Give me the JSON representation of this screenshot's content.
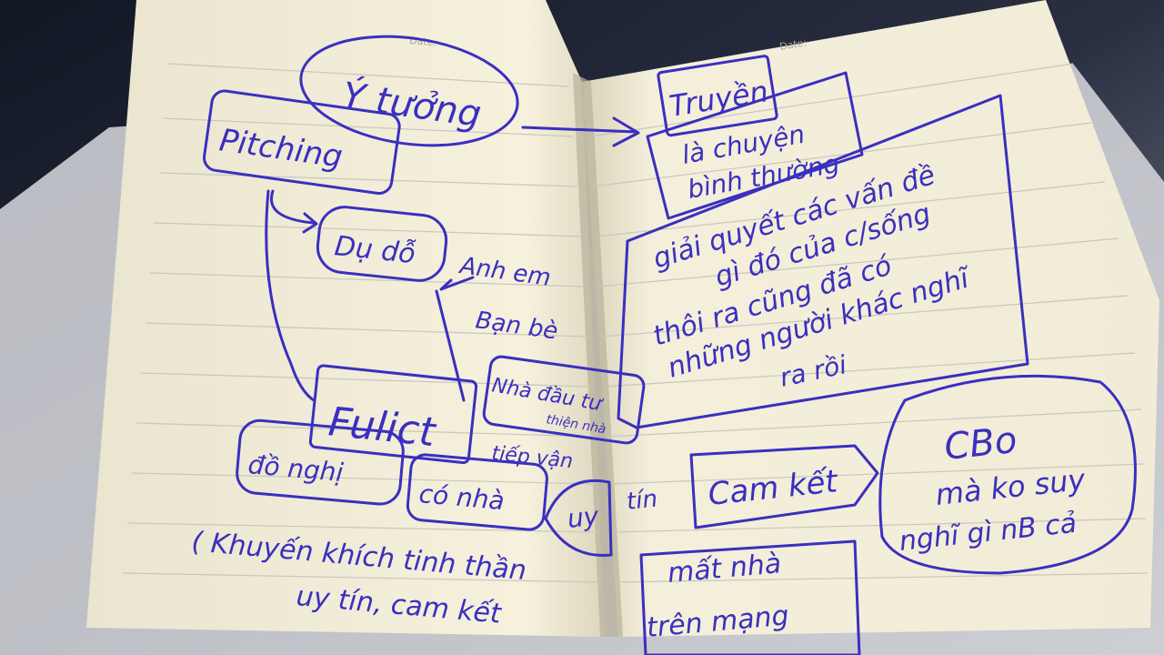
{
  "notebook": {
    "left_page": {
      "date_label": "Date:",
      "idea": "Ý tưởng",
      "pitching": "Pitching",
      "du_do": "Dụ dỗ",
      "anh_em": "Anh em",
      "ban_be": "Bạn bè",
      "nha_dau_tu": "Nhà đầu tư",
      "thiet_nha": "thiện nhà",
      "fulict": "Fulict",
      "dong_nghiep": "đồ nghị",
      "co_nha": "có nhà",
      "tiep_van": "tiếp vận",
      "note_line1": "( Khuyến khích tinh thần",
      "note_line2": "uy tín, cam kết"
    },
    "right_page": {
      "date_label": "Date:",
      "truyen": "Truyền",
      "la_chuyen": "là chuyện",
      "binh_thuong": "bình thường",
      "giai_quyet": "giải quyết các vấn đề",
      "gi_do": "gì đó của c/sống",
      "thoi_ra": "thôi ra cũng đã có",
      "nhung_nguoi": "những người khác nghĩ",
      "ra_roi": "ra rồi",
      "uy": "uy",
      "tin": "tín",
      "cam_ket": "Cam kết",
      "mat_nhau": "mất nhà",
      "tren_mang": "trên mạng",
      "cbo": "CBo",
      "ma_ko_suy": "mà ko suy",
      "nghi_gi": "nghĩ gì nB cả"
    }
  },
  "colors": {
    "ink": "#3a2fc0",
    "paper": "#f5f0dc",
    "background": "#1c2233"
  }
}
